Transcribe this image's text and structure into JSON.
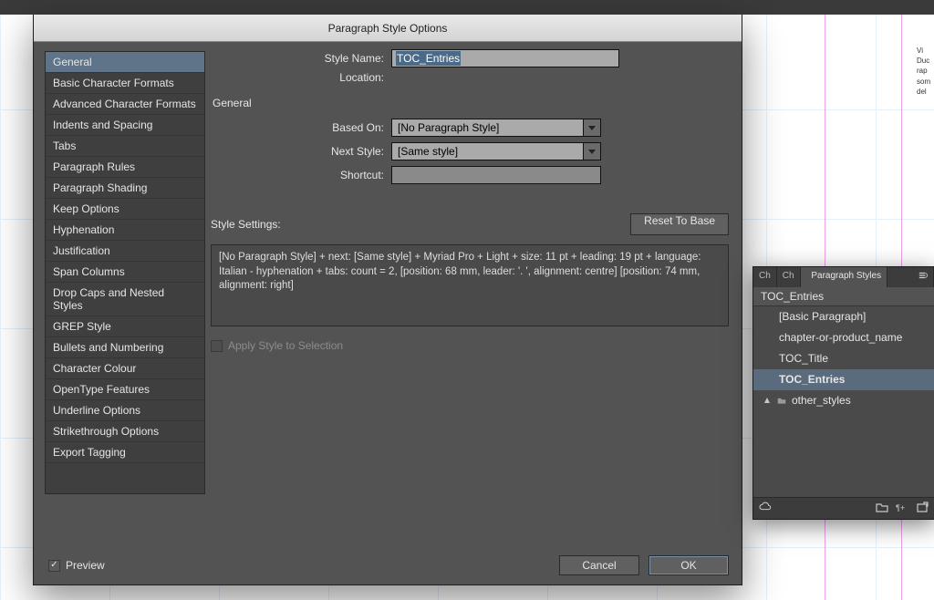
{
  "dialog": {
    "title": "Paragraph Style Options",
    "sidebar": {
      "items": [
        "General",
        "Basic Character Formats",
        "Advanced Character Formats",
        "Indents and Spacing",
        "Tabs",
        "Paragraph Rules",
        "Paragraph Shading",
        "Keep Options",
        "Hyphenation",
        "Justification",
        "Span Columns",
        "Drop Caps and Nested Styles",
        "GREP Style",
        "Bullets and Numbering",
        "Character Colour",
        "OpenType Features",
        "Underline Options",
        "Strikethrough Options",
        "Export Tagging"
      ],
      "selected_index": 0
    },
    "form": {
      "style_name_label": "Style Name:",
      "style_name_value": "TOC_Entries",
      "location_label": "Location:",
      "section_title": "General",
      "based_on_label": "Based On:",
      "based_on_value": "[No Paragraph Style]",
      "next_style_label": "Next Style:",
      "next_style_value": "[Same style]",
      "shortcut_label": "Shortcut:",
      "style_settings_label": "Style Settings:",
      "reset_label": "Reset To Base",
      "style_settings_text": "[No Paragraph Style] + next: [Same style] + Myriad Pro + Light + size: 11 pt + leading: 19 pt + language: Italian - hyphenation + tabs: count = 2, [position: 68 mm, leader: '. ', alignment: centre] [position: 74 mm, alignment: right]",
      "apply_label": "Apply Style to Selection"
    },
    "footer": {
      "preview_label": "Preview",
      "cancel_label": "Cancel",
      "ok_label": "OK"
    }
  },
  "panel": {
    "tab1": "Ch",
    "tab2": "Ch",
    "tab3": "Paragraph Styles",
    "current_style": "TOC_Entries",
    "items": [
      {
        "label": "[Basic Paragraph]"
      },
      {
        "label": "chapter-or-product_name"
      },
      {
        "label": "TOC_Title"
      },
      {
        "label": "TOC_Entries",
        "selected": true,
        "bold": true
      }
    ],
    "folder_label": "other_styles"
  },
  "bg_text": "Vi\nDuc\nrap\nsom\ndel"
}
